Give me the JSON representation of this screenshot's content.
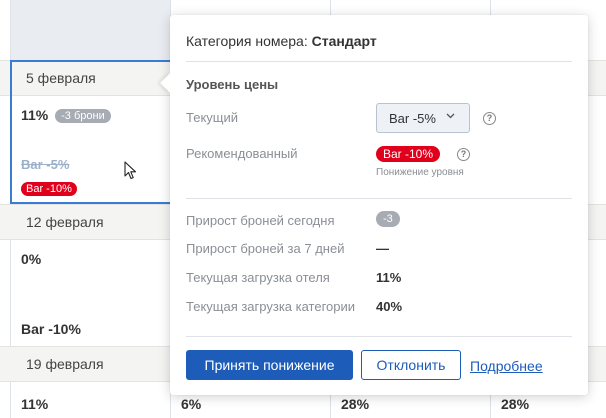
{
  "calendar": {
    "rows": [
      {
        "date": "5 февраля",
        "occupancy": "11%",
        "booking_delta": "-3 брони",
        "old_rate": "Bar -5%",
        "new_rate": "Bar -10%"
      },
      {
        "date": "12 февраля",
        "occupancy": "0%",
        "rate": "Bar -10%"
      },
      {
        "date": "19 февраля",
        "occupancies": [
          "11%",
          "6%",
          "28%",
          "28%"
        ]
      }
    ]
  },
  "popover": {
    "category_label": "Категория номера:",
    "category_value": "Стандарт",
    "section_title": "Уровень цены",
    "current_label": "Текущий",
    "current_value": "Bar -5%",
    "recommended_label": "Рекомендованный",
    "recommended_value": "Bar -10%",
    "recommended_note": "Понижение уровня",
    "stats": [
      {
        "label": "Прирост броней сегодня",
        "value": "-3"
      },
      {
        "label": "Прирост броней за 7 дней",
        "value": "—"
      },
      {
        "label": "Текущая загрузка отеля",
        "value": "11%"
      },
      {
        "label": "Текущая загрузка категории",
        "value": "40%"
      }
    ],
    "accept_label": "Принять понижение",
    "decline_label": "Отклонить",
    "more_label": "Подробнее"
  },
  "colors": {
    "primary": "#1d5cb8",
    "danger": "#e0001b",
    "neutral_badge": "#a7abb3"
  }
}
